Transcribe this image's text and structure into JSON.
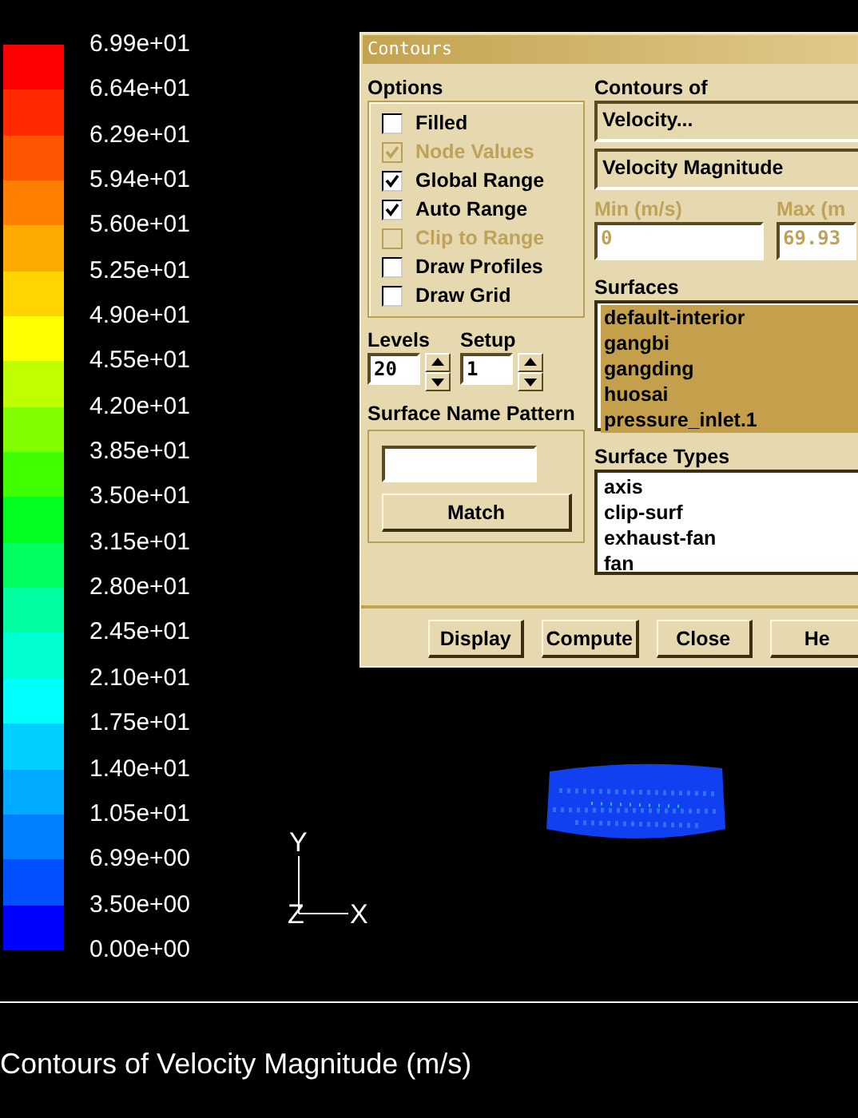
{
  "legend": {
    "swatches": [
      {
        "color": "#ff0000"
      },
      {
        "color": "#ff2a00"
      },
      {
        "color": "#ff5500"
      },
      {
        "color": "#ff7f00"
      },
      {
        "color": "#ffaa00"
      },
      {
        "color": "#ffd400"
      },
      {
        "color": "#ffff00"
      },
      {
        "color": "#c0ff00"
      },
      {
        "color": "#80ff00"
      },
      {
        "color": "#40ff00"
      },
      {
        "color": "#00ff20"
      },
      {
        "color": "#00ff60"
      },
      {
        "color": "#00ffa0"
      },
      {
        "color": "#00ffd0"
      },
      {
        "color": "#00ffff"
      },
      {
        "color": "#00d0ff"
      },
      {
        "color": "#00aaff"
      },
      {
        "color": "#0080ff"
      },
      {
        "color": "#0050ff"
      },
      {
        "color": "#0000ff"
      }
    ],
    "labels": [
      "6.99e+01",
      "6.64e+01",
      "6.29e+01",
      "5.94e+01",
      "5.60e+01",
      "5.25e+01",
      "4.90e+01",
      "4.55e+01",
      "4.20e+01",
      "3.85e+01",
      "3.50e+01",
      "3.15e+01",
      "2.80e+01",
      "2.45e+01",
      "2.10e+01",
      "1.75e+01",
      "1.40e+01",
      "1.05e+01",
      "6.99e+00",
      "3.50e+00",
      "0.00e+00"
    ]
  },
  "axes": {
    "y": "Y",
    "z": "Z",
    "x": "X"
  },
  "caption": "Contours of Velocity Magnitude (m/s)",
  "dialog": {
    "title": "Contours",
    "options": {
      "label": "Options",
      "items": [
        {
          "label": "Filled",
          "checked": false,
          "disabled": false
        },
        {
          "label": "Node Values",
          "checked": true,
          "disabled": true
        },
        {
          "label": "Global Range",
          "checked": true,
          "disabled": false
        },
        {
          "label": "Auto Range",
          "checked": true,
          "disabled": false
        },
        {
          "label": "Clip to Range",
          "checked": false,
          "disabled": true
        },
        {
          "label": "Draw Profiles",
          "checked": false,
          "disabled": false
        },
        {
          "label": "Draw Grid",
          "checked": false,
          "disabled": false
        }
      ]
    },
    "levels": {
      "label": "Levels",
      "value": "20"
    },
    "setup": {
      "label": "Setup",
      "value": "1"
    },
    "pattern": {
      "label": "Surface Name Pattern",
      "button": "Match"
    },
    "contours_of": {
      "label": "Contours of",
      "category": "Velocity...",
      "quantity": "Velocity Magnitude"
    },
    "min": {
      "label": "Min (m/s)",
      "value": "0"
    },
    "max": {
      "label": "Max (m",
      "value": "69.93"
    },
    "surfaces": {
      "label": "Surfaces",
      "items": [
        {
          "label": "default-interior",
          "selected": true
        },
        {
          "label": "gangbi",
          "selected": true
        },
        {
          "label": "gangding",
          "selected": true
        },
        {
          "label": "huosai",
          "selected": true
        },
        {
          "label": "pressure_inlet.1",
          "selected": true
        }
      ]
    },
    "surface_types": {
      "label": "Surface Types",
      "items": [
        {
          "label": "axis",
          "selected": false
        },
        {
          "label": "clip-surf",
          "selected": false
        },
        {
          "label": "exhaust-fan",
          "selected": false
        },
        {
          "label": "fan",
          "selected": false
        }
      ]
    },
    "buttons": [
      "Display",
      "Compute",
      "Close",
      "He"
    ]
  }
}
